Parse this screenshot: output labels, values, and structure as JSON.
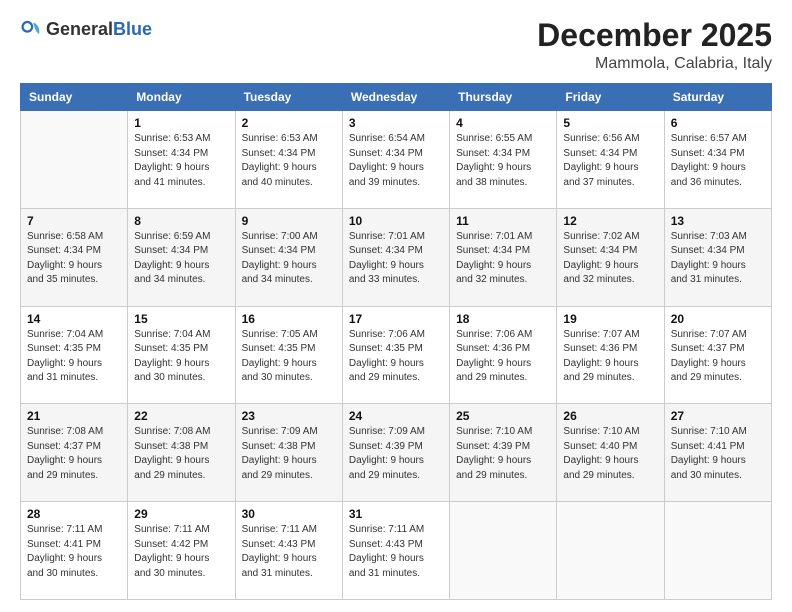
{
  "logo": {
    "text_general": "General",
    "text_blue": "Blue"
  },
  "title": "December 2025",
  "location": "Mammola, Calabria, Italy",
  "weekdays": [
    "Sunday",
    "Monday",
    "Tuesday",
    "Wednesday",
    "Thursday",
    "Friday",
    "Saturday"
  ],
  "weeks": [
    [
      {
        "day": "",
        "info": ""
      },
      {
        "day": "1",
        "info": "Sunrise: 6:53 AM\nSunset: 4:34 PM\nDaylight: 9 hours\nand 41 minutes."
      },
      {
        "day": "2",
        "info": "Sunrise: 6:53 AM\nSunset: 4:34 PM\nDaylight: 9 hours\nand 40 minutes."
      },
      {
        "day": "3",
        "info": "Sunrise: 6:54 AM\nSunset: 4:34 PM\nDaylight: 9 hours\nand 39 minutes."
      },
      {
        "day": "4",
        "info": "Sunrise: 6:55 AM\nSunset: 4:34 PM\nDaylight: 9 hours\nand 38 minutes."
      },
      {
        "day": "5",
        "info": "Sunrise: 6:56 AM\nSunset: 4:34 PM\nDaylight: 9 hours\nand 37 minutes."
      },
      {
        "day": "6",
        "info": "Sunrise: 6:57 AM\nSunset: 4:34 PM\nDaylight: 9 hours\nand 36 minutes."
      }
    ],
    [
      {
        "day": "7",
        "info": "Sunrise: 6:58 AM\nSunset: 4:34 PM\nDaylight: 9 hours\nand 35 minutes."
      },
      {
        "day": "8",
        "info": "Sunrise: 6:59 AM\nSunset: 4:34 PM\nDaylight: 9 hours\nand 34 minutes."
      },
      {
        "day": "9",
        "info": "Sunrise: 7:00 AM\nSunset: 4:34 PM\nDaylight: 9 hours\nand 34 minutes."
      },
      {
        "day": "10",
        "info": "Sunrise: 7:01 AM\nSunset: 4:34 PM\nDaylight: 9 hours\nand 33 minutes."
      },
      {
        "day": "11",
        "info": "Sunrise: 7:01 AM\nSunset: 4:34 PM\nDaylight: 9 hours\nand 32 minutes."
      },
      {
        "day": "12",
        "info": "Sunrise: 7:02 AM\nSunset: 4:34 PM\nDaylight: 9 hours\nand 32 minutes."
      },
      {
        "day": "13",
        "info": "Sunrise: 7:03 AM\nSunset: 4:34 PM\nDaylight: 9 hours\nand 31 minutes."
      }
    ],
    [
      {
        "day": "14",
        "info": "Sunrise: 7:04 AM\nSunset: 4:35 PM\nDaylight: 9 hours\nand 31 minutes."
      },
      {
        "day": "15",
        "info": "Sunrise: 7:04 AM\nSunset: 4:35 PM\nDaylight: 9 hours\nand 30 minutes."
      },
      {
        "day": "16",
        "info": "Sunrise: 7:05 AM\nSunset: 4:35 PM\nDaylight: 9 hours\nand 30 minutes."
      },
      {
        "day": "17",
        "info": "Sunrise: 7:06 AM\nSunset: 4:35 PM\nDaylight: 9 hours\nand 29 minutes."
      },
      {
        "day": "18",
        "info": "Sunrise: 7:06 AM\nSunset: 4:36 PM\nDaylight: 9 hours\nand 29 minutes."
      },
      {
        "day": "19",
        "info": "Sunrise: 7:07 AM\nSunset: 4:36 PM\nDaylight: 9 hours\nand 29 minutes."
      },
      {
        "day": "20",
        "info": "Sunrise: 7:07 AM\nSunset: 4:37 PM\nDaylight: 9 hours\nand 29 minutes."
      }
    ],
    [
      {
        "day": "21",
        "info": "Sunrise: 7:08 AM\nSunset: 4:37 PM\nDaylight: 9 hours\nand 29 minutes."
      },
      {
        "day": "22",
        "info": "Sunrise: 7:08 AM\nSunset: 4:38 PM\nDaylight: 9 hours\nand 29 minutes."
      },
      {
        "day": "23",
        "info": "Sunrise: 7:09 AM\nSunset: 4:38 PM\nDaylight: 9 hours\nand 29 minutes."
      },
      {
        "day": "24",
        "info": "Sunrise: 7:09 AM\nSunset: 4:39 PM\nDaylight: 9 hours\nand 29 minutes."
      },
      {
        "day": "25",
        "info": "Sunrise: 7:10 AM\nSunset: 4:39 PM\nDaylight: 9 hours\nand 29 minutes."
      },
      {
        "day": "26",
        "info": "Sunrise: 7:10 AM\nSunset: 4:40 PM\nDaylight: 9 hours\nand 29 minutes."
      },
      {
        "day": "27",
        "info": "Sunrise: 7:10 AM\nSunset: 4:41 PM\nDaylight: 9 hours\nand 30 minutes."
      }
    ],
    [
      {
        "day": "28",
        "info": "Sunrise: 7:11 AM\nSunset: 4:41 PM\nDaylight: 9 hours\nand 30 minutes."
      },
      {
        "day": "29",
        "info": "Sunrise: 7:11 AM\nSunset: 4:42 PM\nDaylight: 9 hours\nand 30 minutes."
      },
      {
        "day": "30",
        "info": "Sunrise: 7:11 AM\nSunset: 4:43 PM\nDaylight: 9 hours\nand 31 minutes."
      },
      {
        "day": "31",
        "info": "Sunrise: 7:11 AM\nSunset: 4:43 PM\nDaylight: 9 hours\nand 31 minutes."
      },
      {
        "day": "",
        "info": ""
      },
      {
        "day": "",
        "info": ""
      },
      {
        "day": "",
        "info": ""
      }
    ]
  ]
}
